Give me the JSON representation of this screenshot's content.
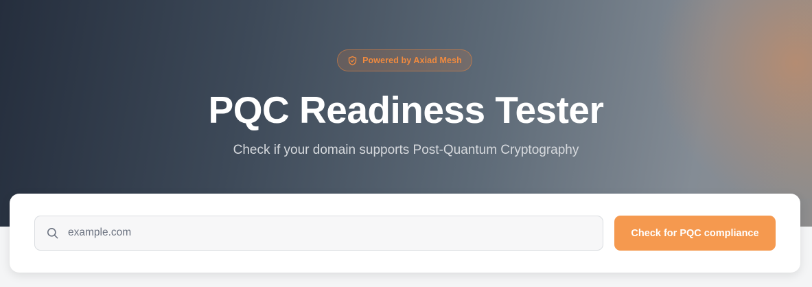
{
  "hero": {
    "badge": {
      "icon": "shield-check-icon",
      "label": "Powered by Axiad Mesh",
      "color": "#f08a3f"
    },
    "title": "PQC Readiness Tester",
    "subtitle": "Check if your domain supports Post-Quantum Cryptography"
  },
  "search": {
    "icon": "search-icon",
    "placeholder": "example.com",
    "value": ""
  },
  "actions": {
    "check_label": "Check for PQC compliance",
    "accent_color": "#f5994f"
  }
}
